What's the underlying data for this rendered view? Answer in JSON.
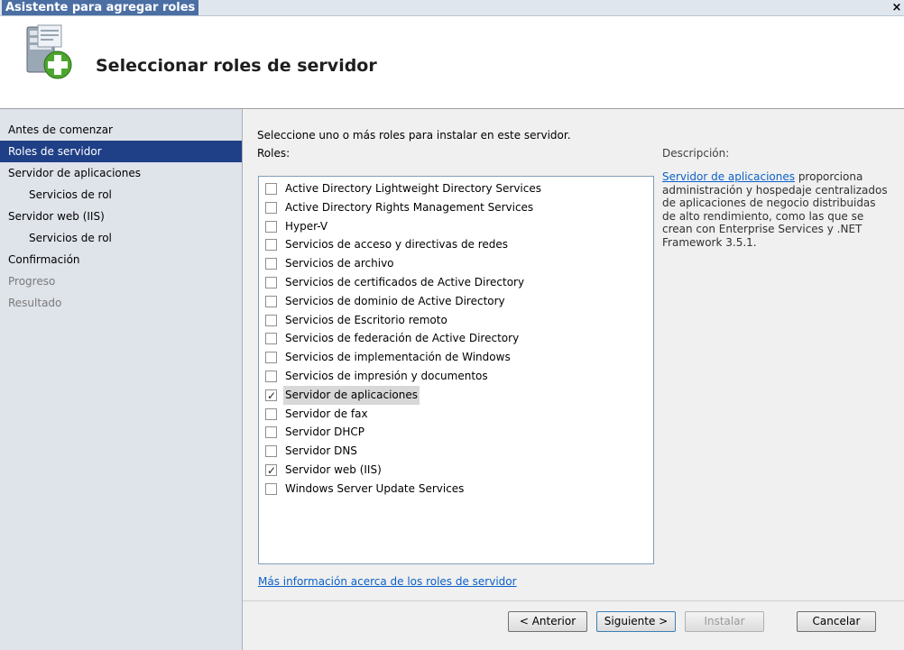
{
  "window": {
    "title": "Asistente para agregar roles",
    "close_label": "×"
  },
  "header": {
    "title": "Seleccionar roles de servidor",
    "icon": "server-add-icon"
  },
  "sidebar": {
    "items": [
      {
        "label": "Antes de comenzar"
      },
      {
        "label": "Roles de servidor"
      },
      {
        "label": "Servidor de aplicaciones"
      },
      {
        "label": "Servicios de rol"
      },
      {
        "label": "Servidor web (IIS)"
      },
      {
        "label": "Servicios de rol"
      },
      {
        "label": "Confirmación"
      },
      {
        "label": "Progreso"
      },
      {
        "label": "Resultado"
      }
    ]
  },
  "main": {
    "instruction": "Seleccione uno o más roles para instalar en este servidor.",
    "roles_label": "Roles:",
    "roles": [
      {
        "label": "Active Directory Lightweight Directory Services",
        "checked": false
      },
      {
        "label": "Active Directory Rights Management Services",
        "checked": false
      },
      {
        "label": "Hyper-V",
        "checked": false
      },
      {
        "label": "Servicios de acceso y directivas de redes",
        "checked": false
      },
      {
        "label": "Servicios de archivo",
        "checked": false
      },
      {
        "label": "Servicios de certificados de Active Directory",
        "checked": false
      },
      {
        "label": "Servicios de dominio de Active Directory",
        "checked": false
      },
      {
        "label": "Servicios de Escritorio remoto",
        "checked": false
      },
      {
        "label": "Servicios de federación de Active Directory",
        "checked": false
      },
      {
        "label": "Servicios de implementación de Windows",
        "checked": false
      },
      {
        "label": "Servicios de impresión y documentos",
        "checked": false
      },
      {
        "label": "Servidor de aplicaciones",
        "checked": true
      },
      {
        "label": "Servidor de fax",
        "checked": false
      },
      {
        "label": "Servidor DHCP",
        "checked": false
      },
      {
        "label": "Servidor DNS",
        "checked": false
      },
      {
        "label": "Servidor web (IIS)",
        "checked": true
      },
      {
        "label": "Windows Server Update Services",
        "checked": false
      }
    ],
    "description_label": "Descripción:",
    "description_link": "Servidor de aplicaciones",
    "description_text": " proporciona administración y hospedaje centralizados de aplicaciones de negocio distribuidas de alto rendimiento, como las que se crean con Enterprise Services y .NET Framework 3.5.1.",
    "more_info_link": "Más información acerca de los roles de servidor"
  },
  "buttons": {
    "previous": "< Anterior",
    "next": "Siguiente >",
    "install": "Instalar",
    "cancel": "Cancelar"
  }
}
